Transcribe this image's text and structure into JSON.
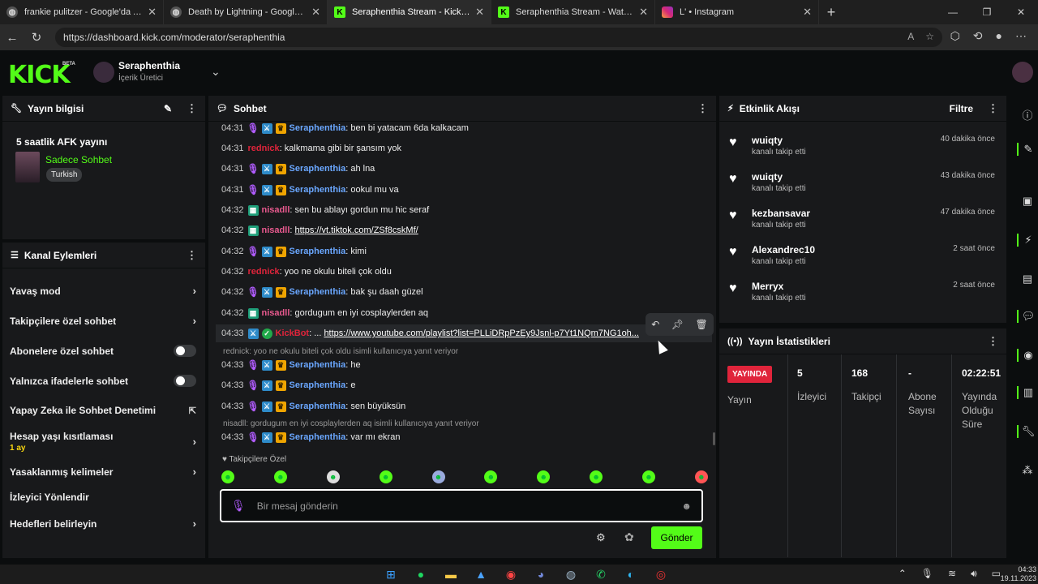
{
  "browser": {
    "tabs": [
      {
        "title": "frankie pulitzer - Google'da Ara",
        "icon": "globe-icon",
        "active": false
      },
      {
        "title": "Death by Lightning - Google'da A",
        "icon": "globe-icon",
        "active": false
      },
      {
        "title": "Seraphenthia Stream - Kick Dashb",
        "icon": "kick-icon",
        "active": true
      },
      {
        "title": "Seraphenthia Stream - Watch Live",
        "icon": "kick-icon",
        "active": false
      },
      {
        "title": "L' • Instagram",
        "icon": "instagram-icon",
        "active": false
      }
    ],
    "url": "https://dashboard.kick.com/moderator/seraphenthia"
  },
  "header": {
    "logo": "KICK",
    "beta": "BETA",
    "channel_name": "Seraphenthia",
    "channel_role": "İçerik Üretici"
  },
  "stream_info": {
    "title": "Yayın bilgisi",
    "stream_title": "5 saatlik AFK yayını",
    "category": "Sadece Sohbet",
    "tag": "Turkish"
  },
  "channel_actions": {
    "title": "Kanal Eylemleri",
    "items": [
      {
        "label": "Yavaş mod",
        "control": "chevron"
      },
      {
        "label": "Takipçilere özel sohbet",
        "control": "chevron"
      },
      {
        "label": "Abonelere özel sohbet",
        "control": "toggle"
      },
      {
        "label": "Yalnızca ifadelerle sohbet",
        "control": "toggle"
      },
      {
        "label": "Yapay Zeka ile Sohbet Denetimi",
        "control": "external"
      },
      {
        "label": "Hesap yaşı kısıtlaması",
        "sub": "1 ay",
        "control": "chevron"
      },
      {
        "label": "Yasaklanmış kelimeler",
        "control": "chevron"
      },
      {
        "label": "İzleyici Yönlendir",
        "control": "none"
      },
      {
        "label": "Hedefleri belirleyin",
        "control": "chevron"
      }
    ]
  },
  "chat": {
    "title": "Sohbet",
    "messages": [
      {
        "time": "04:31",
        "user": "Seraphenthia",
        "type": "owner",
        "text": ": ben bi yatacam 6da kalkacam"
      },
      {
        "time": "04:31",
        "user": "rednick",
        "type": "red",
        "text": ": kalkmama gibi bir şansım yok"
      },
      {
        "time": "04:31",
        "user": "Seraphenthia",
        "type": "owner",
        "text": ": ah lna"
      },
      {
        "time": "04:31",
        "user": "Seraphenthia",
        "type": "owner",
        "text": ": ookul mu va"
      },
      {
        "time": "04:32",
        "user": "nisadll",
        "type": "sub",
        "text": ": sen bu ablayı gordun mu hic seraf"
      },
      {
        "time": "04:32",
        "user": "nisadll",
        "type": "sub",
        "text": ": ",
        "link": "https://vt.tiktok.com/ZSf8cskMf/"
      },
      {
        "time": "04:32",
        "user": "Seraphenthia",
        "type": "owner",
        "text": ": kimi"
      },
      {
        "time": "04:32",
        "user": "rednick",
        "type": "red",
        "text": ": yoo ne okulu biteli çok oldu"
      },
      {
        "time": "04:32",
        "user": "Seraphenthia",
        "type": "owner",
        "text": ": bak şu daah güzel"
      },
      {
        "time": "04:32",
        "user": "nisadll",
        "type": "sub",
        "text": ": gordugum en iyi cosplaylerden aq"
      },
      {
        "time": "04:33",
        "user": "KickBot",
        "type": "bot",
        "text": ": ... ",
        "link": "https://www.youtube.com/playlist?list=PLLiDRpPzEy9Jsnl-p7Yt1NQm7NG1oh..."
      },
      {
        "time": "04:33",
        "user": "Seraphenthia",
        "type": "owner",
        "text": ": he",
        "reply": "rednick: yoo ne okulu biteli çok oldu isimli kullanıcıya yanıt veriyor"
      },
      {
        "time": "04:33",
        "user": "Seraphenthia",
        "type": "owner",
        "text": ": e"
      },
      {
        "time": "04:33",
        "user": "Seraphenthia",
        "type": "owner",
        "text": ": sen büyüksün"
      },
      {
        "time": "04:33",
        "user": "Seraphenthia",
        "type": "owner",
        "text": ": var mı ekran",
        "reply": "nisadll: gordugum en iyi cosplaylerden aq isimli kullanıcıya yanıt veriyor"
      }
    ],
    "emote_section": "Takipçilere Özel",
    "input_placeholder": "Bir mesaj gönderin",
    "send_label": "Gönder"
  },
  "activity": {
    "title": "Etkinlik Akışı",
    "filter_label": "Filtre",
    "events": [
      {
        "name": "wuiqty",
        "desc": "kanalı takip etti",
        "time": "40 dakika önce"
      },
      {
        "name": "wuiqty",
        "desc": "kanalı takip etti",
        "time": "43 dakika önce"
      },
      {
        "name": "kezbansavar",
        "desc": "kanalı takip etti",
        "time": "47 dakika önce"
      },
      {
        "name": "Alexandrec10",
        "desc": "kanalı takip etti",
        "time": "2 saat önce"
      },
      {
        "name": "Merryx",
        "desc": "kanalı takip etti",
        "time": "2 saat önce"
      }
    ]
  },
  "stats": {
    "title": "Yayın İstatistikleri",
    "live_badge": "YAYINDA",
    "live_label": "Yayın",
    "viewers": "5",
    "viewers_label": "İzleyici",
    "followers": "168",
    "followers_label": "Takipçi",
    "subs": "-",
    "subs_label": "Abone Sayısı",
    "uptime": "02:22:51",
    "uptime_label": "Yayında Olduğu Süre"
  },
  "taskbar": {
    "time": "04:33",
    "date": "19.11.2023"
  },
  "colors": {
    "accent": "#53fc18",
    "background": "#0b0d0e",
    "panel": "#18191b",
    "live_red": "#e0243b",
    "owner_name": "#6aa7ff"
  }
}
